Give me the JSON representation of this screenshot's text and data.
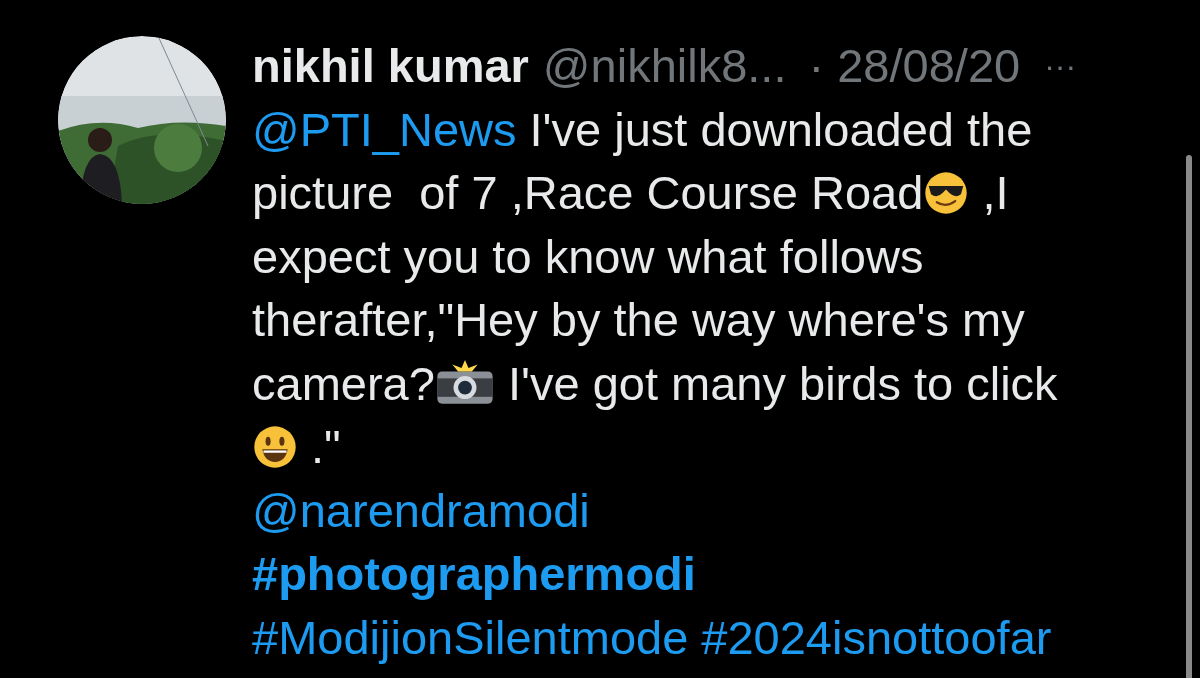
{
  "tweet": {
    "author": {
      "name": "nikhil kumar",
      "handle": "@nikhilk8...",
      "date": "· 28/08/20",
      "more": "···"
    },
    "lines": [
      [
        {
          "kind": "mention",
          "text": "@PTI_News"
        },
        {
          "kind": "text",
          "text": " I've just downloaded the"
        }
      ],
      [
        {
          "kind": "text",
          "text": "picture  of 7 ,Race Course Road"
        },
        {
          "kind": "sunglasses_emoji"
        },
        {
          "kind": "text",
          "text": " ,I"
        }
      ],
      [
        {
          "kind": "text",
          "text": "expect you to know what follows"
        }
      ],
      [
        {
          "kind": "text",
          "text": "therafter,\"Hey by the way where's my"
        }
      ],
      [
        {
          "kind": "text",
          "text": "camera?"
        },
        {
          "kind": "camera_emoji"
        },
        {
          "kind": "text",
          "text": " I've got many birds to click"
        }
      ],
      [
        {
          "kind": "smile_emoji"
        },
        {
          "kind": "text",
          "text": " .\""
        }
      ],
      [
        {
          "kind": "mention",
          "text": "@narendramodi"
        }
      ],
      [
        {
          "kind": "hashtag",
          "text": "#photographermodi",
          "bold": true
        }
      ],
      [
        {
          "kind": "hashtag",
          "text": "#ModijionSilentmode",
          "bold": false
        },
        {
          "kind": "hashtag",
          "text": "#2024isnottoofar",
          "bold": false
        }
      ]
    ]
  }
}
